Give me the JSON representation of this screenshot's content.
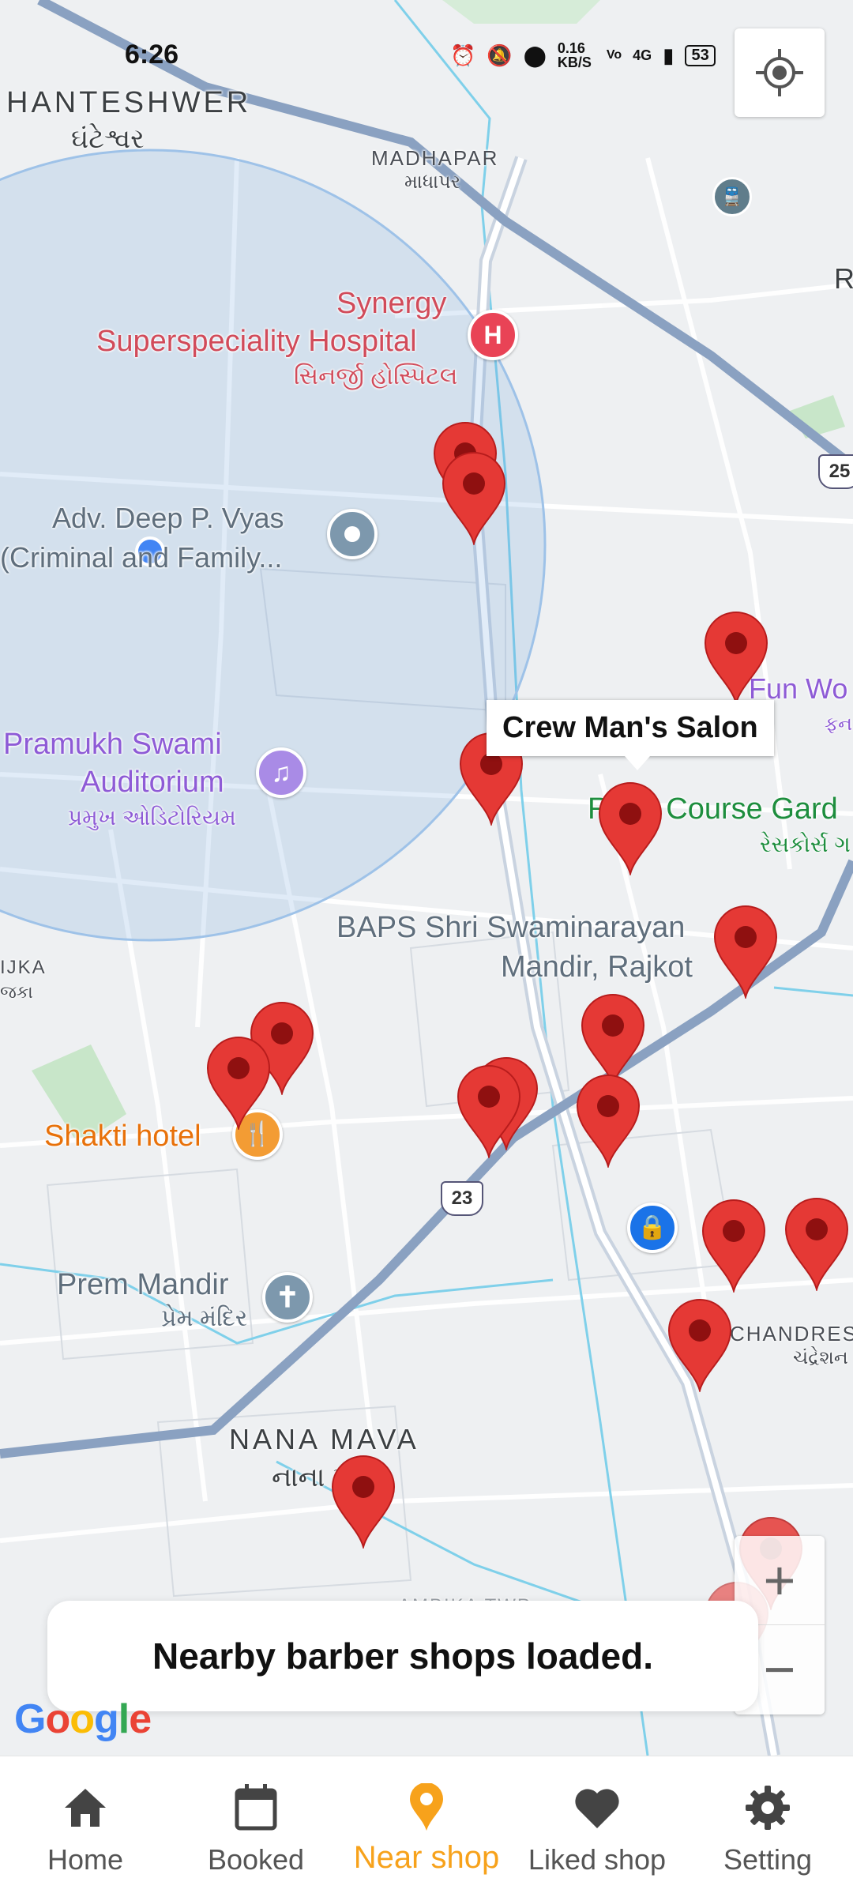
{
  "status_bar": {
    "time": "6:26",
    "network_speed": "0.16 KB/S",
    "signal": "4G",
    "battery": "53"
  },
  "map": {
    "labels": {
      "ghanteshwar_en": "HANTESHWER",
      "ghanteshwar_gu": "ઘંટેશ્વર",
      "madhapar_en": "MADHAPAR",
      "madhapar_gu": "માધાપર",
      "hospital_l1": "Synergy",
      "hospital_l2": "Superspeciality Hospital",
      "hospital_gu": "સિનર્જી હોસ્પિટલ",
      "advocate_l1": "Adv. Deep P. Vyas",
      "advocate_l2": "(Criminal and Family...",
      "auditorium_l1": "Pramukh Swami",
      "auditorium_l2": "Auditorium",
      "auditorium_gu": "પ્રમુખ ઓડિટોરિયમ",
      "funworld": "Fun Wo",
      "funworld_gu": "ફન",
      "racecourse": "Race Course Gard",
      "racecourse_gu": "રેસકોર્સ ગ",
      "baps_l1": "BAPS Shri Swaminarayan",
      "baps_l2": "Mandir, Rajkot",
      "ijka": "IJKA",
      "ijka_gu": "જકા",
      "shakti": "Shakti hotel",
      "prem_en": "Prem Mandir",
      "prem_gu": "પ્રેમ મંદિર",
      "nanamava_en": "NANA MAVA",
      "nanamava_gu": "નાના મવા",
      "chandresh_en": "CHANDRES",
      "chandresh_gu": "ચંદ્રેશન",
      "ambika": "AMBIKA TWP",
      "road_r": "R",
      "highway_23": "23",
      "highway_25": "25"
    },
    "selected_shop": "Crew Man's Salon",
    "attribution": "Google"
  },
  "toast": {
    "message": "Nearby barber shops loaded."
  },
  "zoom": {
    "in": "+",
    "out": "−"
  },
  "nav": {
    "items": [
      {
        "label": "Home",
        "icon": "home-icon"
      },
      {
        "label": "Booked",
        "icon": "calendar-icon"
      },
      {
        "label": "Near shop",
        "icon": "location-pin-icon"
      },
      {
        "label": "Liked shop",
        "icon": "heart-icon"
      },
      {
        "label": "Setting",
        "icon": "gear-icon"
      }
    ],
    "active": "Near shop",
    "active_color": "#f7a21b"
  },
  "colors": {
    "pin_red": "#e53935",
    "hospital_label": "#d14b5a",
    "poi_purple": "#8e5bd6",
    "park_green": "#1e8e3e",
    "food_orange": "#e8710a",
    "road_blue": "#8aa1c1"
  }
}
